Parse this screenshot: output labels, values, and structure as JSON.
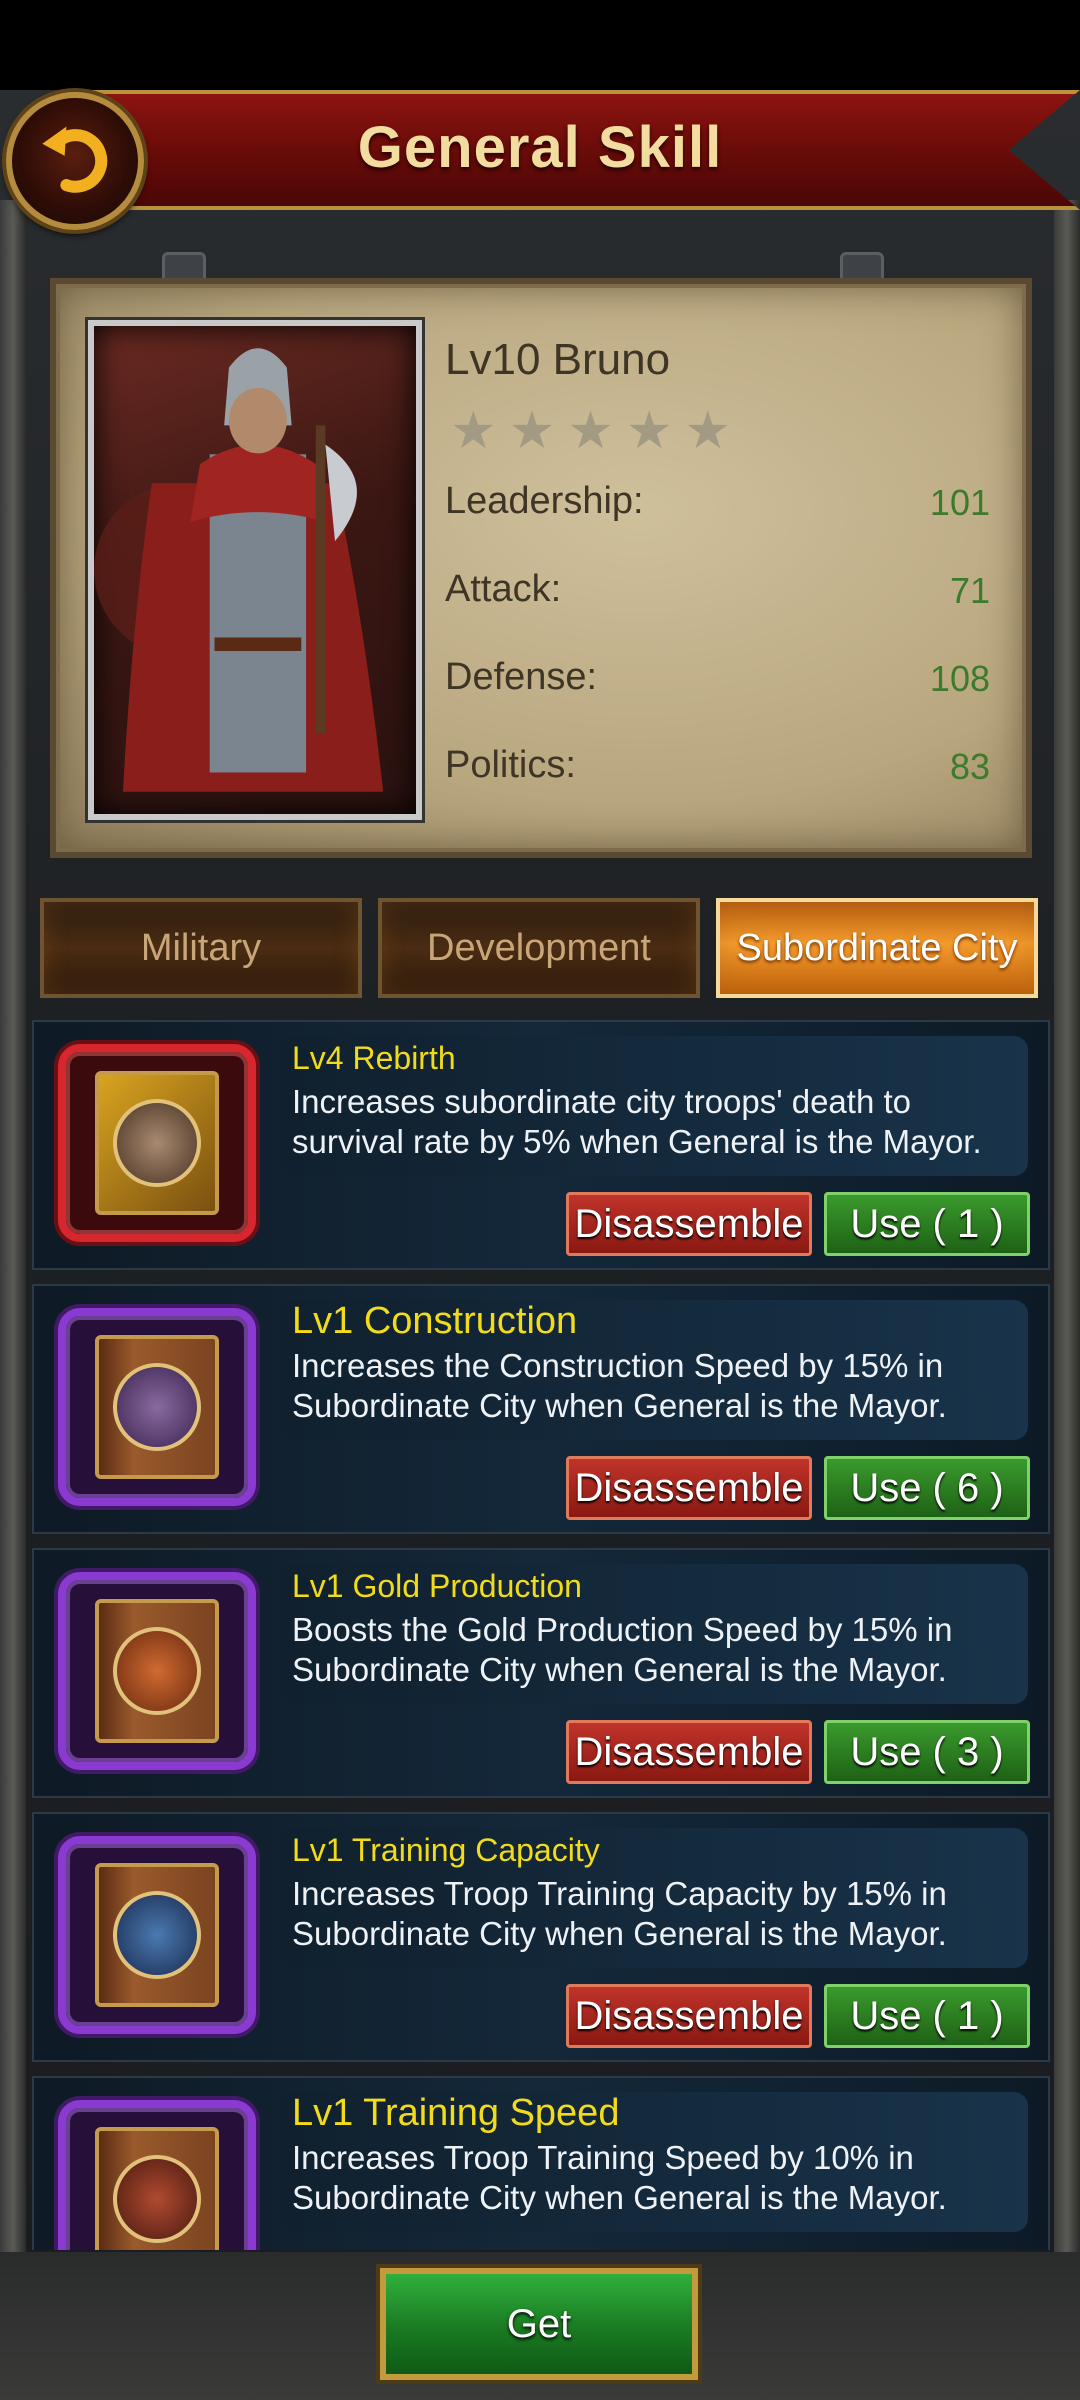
{
  "header": {
    "title": "General Skill"
  },
  "general": {
    "name": "Lv10 Bruno",
    "stars": 5,
    "stats": [
      {
        "label": "Leadership:",
        "value": "101"
      },
      {
        "label": "Attack:",
        "value": "71"
      },
      {
        "label": "Defense:",
        "value": "108"
      },
      {
        "label": "Politics:",
        "value": "83"
      }
    ]
  },
  "tabs": [
    {
      "label": "Military",
      "active": false
    },
    {
      "label": "Development",
      "active": false
    },
    {
      "label": "Subordinate City",
      "active": true
    }
  ],
  "skills": [
    {
      "name": "Lv4 Rebirth",
      "desc": "Increases subordinate city troops' death to survival rate by 5% when General is the Mayor.",
      "disassemble": "Disassemble",
      "use": "Use ( 1 )",
      "rarity": "red",
      "icon": "rebirth-book-icon"
    },
    {
      "name": "Lv1 Construction",
      "desc": "Increases the Construction Speed by 15% in Subordinate City when General is the Mayor.",
      "disassemble": "Disassemble",
      "use": "Use ( 6 )",
      "rarity": "purple",
      "icon": "construction-book-icon"
    },
    {
      "name": "Lv1 Gold Production",
      "desc": "Boosts the Gold Production Speed by 15% in Subordinate City when General is the Mayor.",
      "disassemble": "Disassemble",
      "use": "Use ( 3 )",
      "rarity": "purple",
      "icon": "gold-production-book-icon"
    },
    {
      "name": "Lv1 Training Capacity",
      "desc": "Increases Troop Training Capacity by 15% in Subordinate City when General is the Mayor.",
      "disassemble": "Disassemble",
      "use": "Use ( 1 )",
      "rarity": "purple",
      "icon": "training-capacity-book-icon"
    },
    {
      "name": "Lv1 Training Speed",
      "desc": "Increases Troop Training Speed by 10% in Subordinate City when General is the Mayor.",
      "disassemble": "",
      "use": "",
      "rarity": "purple",
      "icon": "training-speed-book-icon"
    }
  ],
  "footer": {
    "get_label": "Get"
  },
  "colors": {
    "accent_gold": "#f2dc1a",
    "stat_green": "#3c7a2c",
    "active_tab": "#f39a2c"
  }
}
